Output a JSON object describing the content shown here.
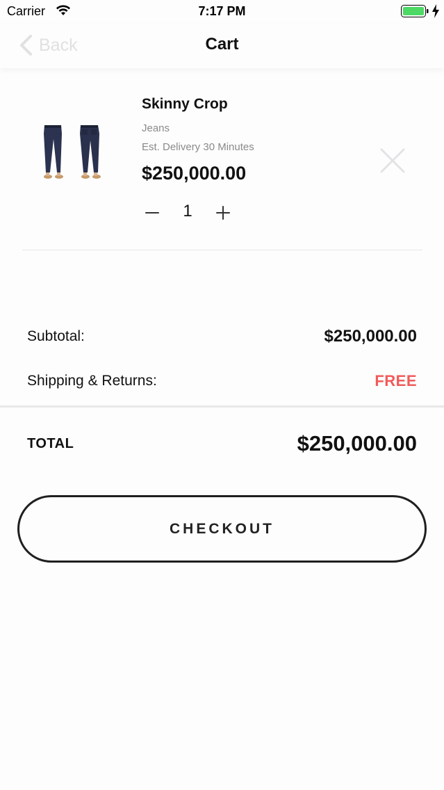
{
  "status_bar": {
    "carrier": "Carrier",
    "time": "7:17 PM",
    "battery_color": "#4cd964"
  },
  "nav": {
    "back_label": "Back",
    "title": "Cart"
  },
  "cart_items": [
    {
      "name": "Skinny Crop",
      "category": "Jeans",
      "delivery": "Est. Delivery 30 Minutes",
      "price": "$250,000.00",
      "quantity": "1",
      "image_icon": "jeans-product-image"
    }
  ],
  "summary": {
    "subtotal_label": "Subtotal:",
    "subtotal_value": "$250,000.00",
    "shipping_label": "Shipping & Returns:",
    "shipping_value": "FREE",
    "total_label": "TOTAL",
    "total_value": "$250,000.00"
  },
  "checkout": {
    "label": "CHECKOUT"
  },
  "colors": {
    "accent_free": "#f25a5a",
    "text": "#111111",
    "muted": "#8a8a8a",
    "disabled": "#e1e1e3"
  }
}
